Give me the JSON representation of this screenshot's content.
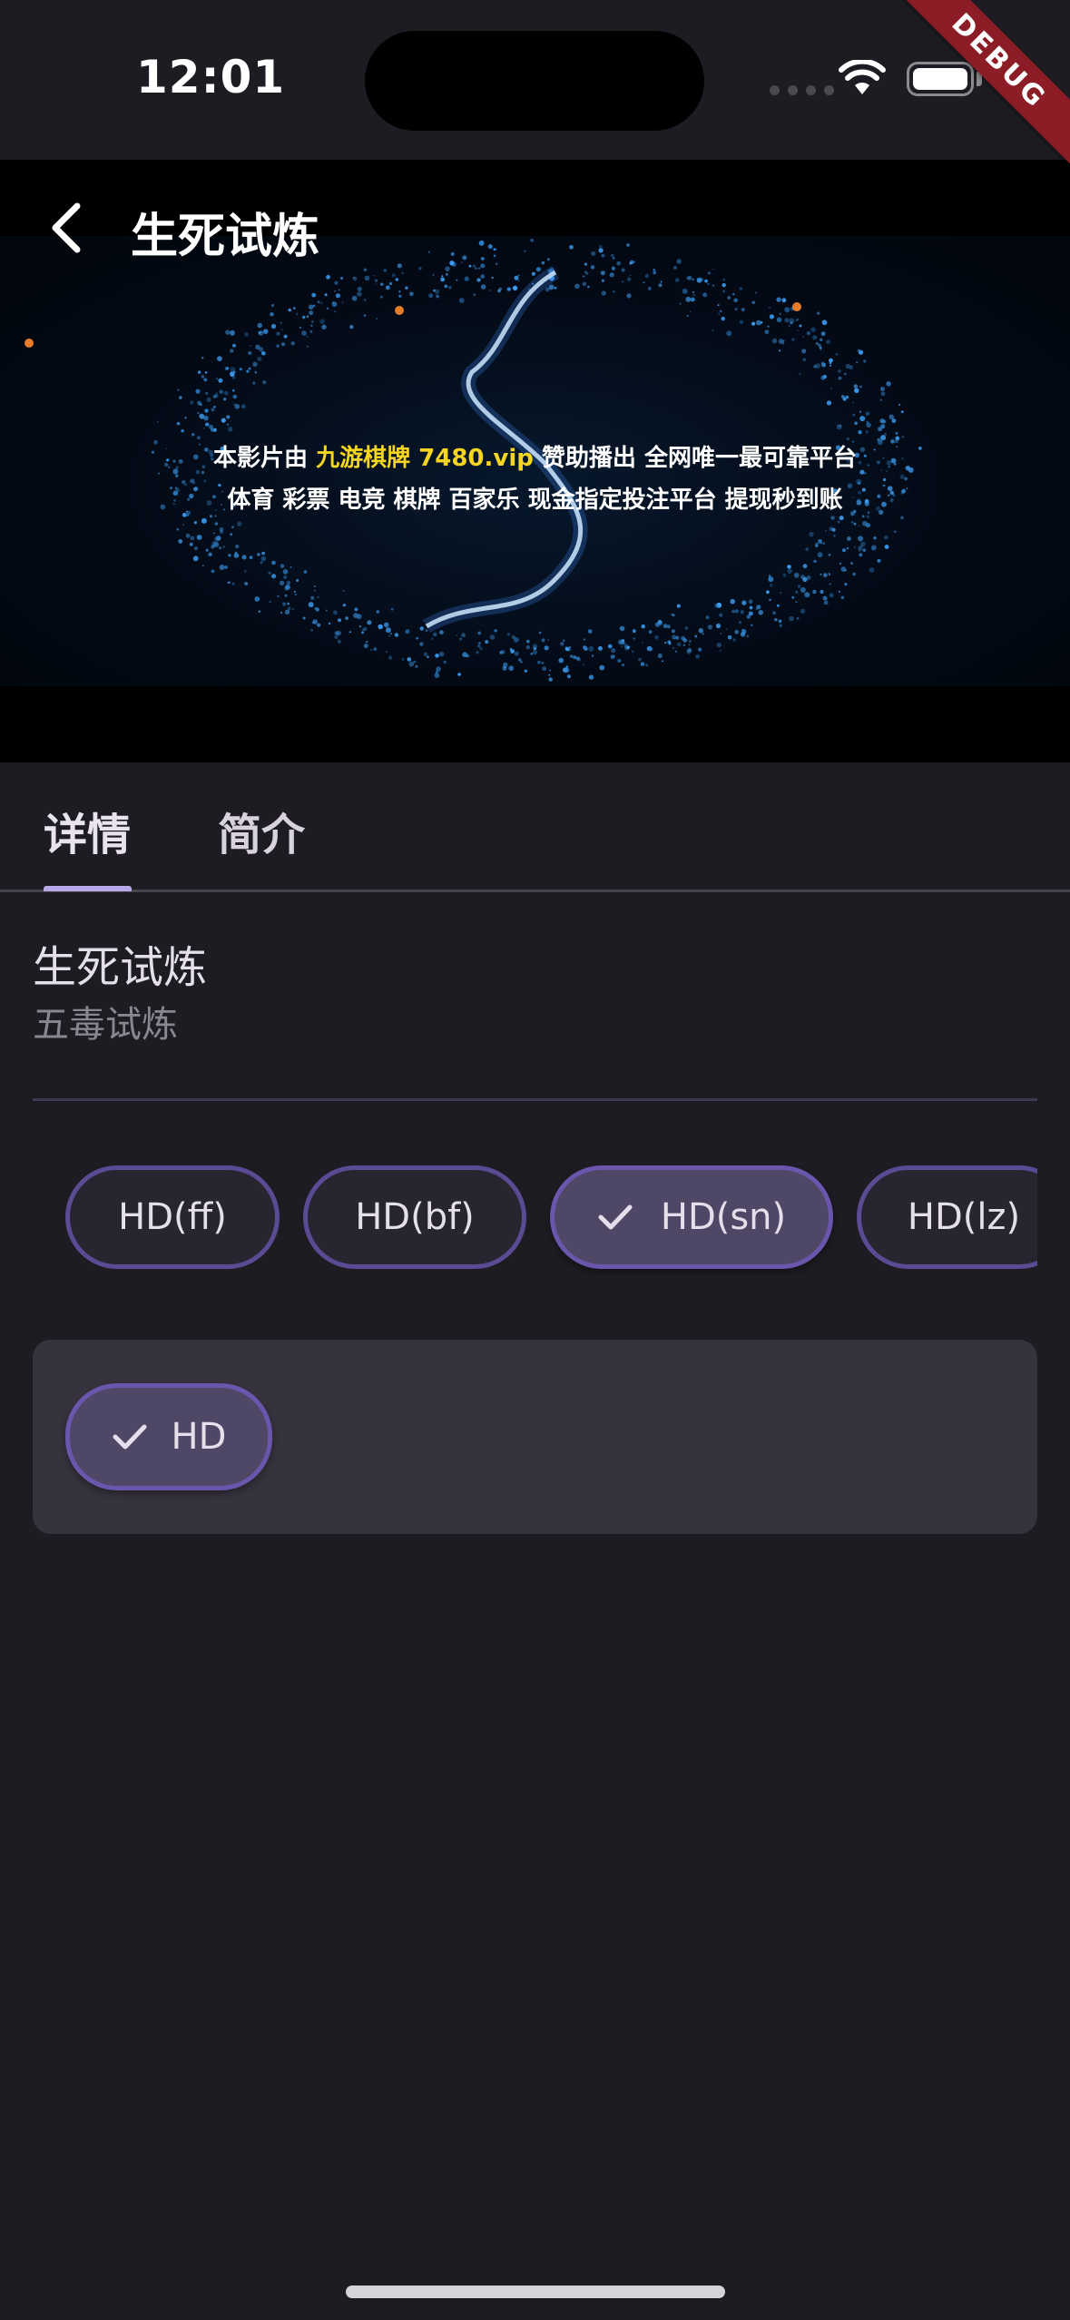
{
  "status_bar": {
    "time": "12:01"
  },
  "debug_banner": {
    "label": "DEBUG"
  },
  "app_bar": {
    "title": "生死试炼"
  },
  "video": {
    "overlay_line1": {
      "prefix": "本影片由 ",
      "highlight": "九游棋牌  7480.vip",
      "suffix": " 赞助播出 全网唯一最可靠平台"
    },
    "overlay_line2": "体育 彩票 电竞 棋牌 百家乐 现金指定投注平台 提现秒到账"
  },
  "tabs": [
    {
      "label": "详情",
      "selected": true
    },
    {
      "label": "简介",
      "selected": false
    }
  ],
  "movie": {
    "title": "生死试炼",
    "subtitle": "五毒试炼"
  },
  "sources": [
    {
      "label": "HD(ff)",
      "selected": false
    },
    {
      "label": "HD(bf)",
      "selected": false
    },
    {
      "label": "HD(sn)",
      "selected": true
    },
    {
      "label": "HD(lz)",
      "selected": false
    }
  ],
  "episodes": [
    {
      "label": "HD",
      "selected": true
    }
  ],
  "icons": {
    "back": "arrow-back-icon",
    "check": "check-icon",
    "wifi": "wifi-icon",
    "battery": "battery-icon"
  },
  "colors": {
    "background": "#1d1c22",
    "accent": "#b9a8e8",
    "chip_border": "#5b4a94",
    "chip_selected": "#4f4766",
    "overlay_highlight": "#f5d51f",
    "debug_ribbon": "#8c1c25"
  }
}
